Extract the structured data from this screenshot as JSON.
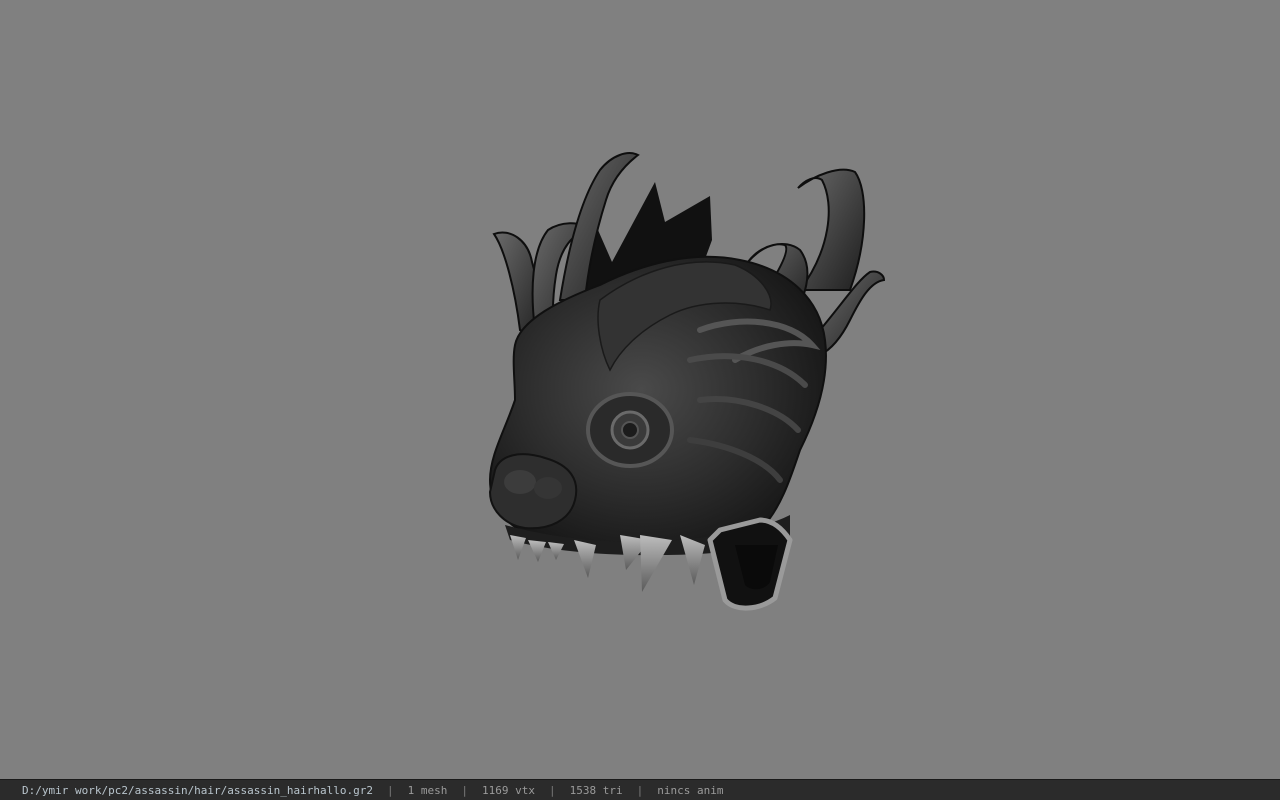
{
  "viewer": {
    "background_color": "#808080",
    "model_icon": "dragon-head-helmet-model"
  },
  "status": {
    "file_path": "D:/ymir work/pc2/assassin/hair/assassin_hairhallo.gr2",
    "separator": "|",
    "mesh_count": "1 mesh",
    "vertex_count": "1169 vtx",
    "triangle_count": "1538 tri",
    "anim_info": "nincs anim"
  }
}
